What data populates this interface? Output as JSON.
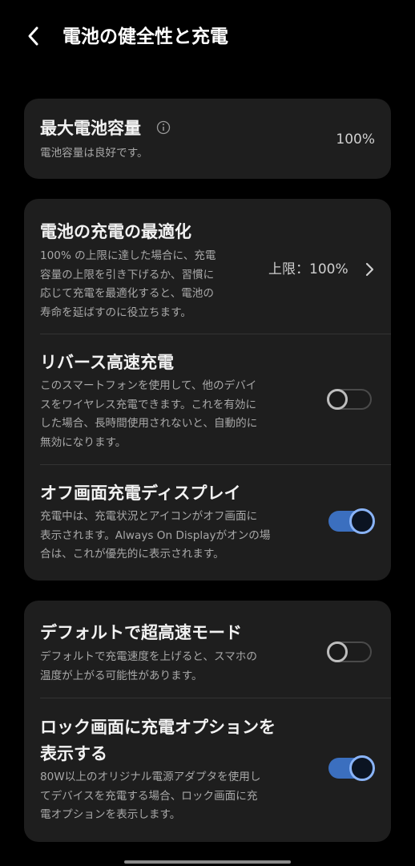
{
  "header": {
    "title": "電池の健全性と充電"
  },
  "capacity": {
    "title": "最大電池容量",
    "description": "電池容量は良好です。",
    "value": "100%"
  },
  "optimization": {
    "title": "電池の充電の最適化",
    "description": "100% の上限に達した場合に、充電\n容量の上限を引き下げるか、習慣に\n応じて充電を最適化すると、電池の\n寿命を延ばすのに役立ちます。",
    "value": "上限：100%"
  },
  "reverse_charging": {
    "title": "リバース高速充電",
    "description": "このスマートフォンを使用して、他のデバイ\nスをワイヤレス充電できます。これを有効に\nした場合、長時間使用されないと、自動的に\n無効になります。",
    "enabled": false
  },
  "off_screen_display": {
    "title": "オフ画面充電ディスプレイ",
    "description": "充電中は、充電状況とアイコンがオフ画面に\n表示されます。Always On Displayがオンの場\n合は、これが優先的に表示されます。",
    "enabled": true
  },
  "hyper_mode": {
    "title": "デフォルトで超高速モード",
    "description": "デフォルトで充電速度を上げると、スマホの\n温度が上がる可能性があります。",
    "enabled": false
  },
  "lock_screen_options": {
    "title_line1": "ロック画面に充電オプションを",
    "title_line2": "表示する",
    "description": "80W以上のオリジナル電源アダプタを使用し\nてデバイスを充電する場合、ロック画面に充\n電オプションを表示します。",
    "enabled": true
  },
  "icons": {
    "back": "chevron-left-icon",
    "info": "info-icon",
    "chevron": "chevron-right-icon"
  },
  "colors": {
    "background": "#000000",
    "card": "#1e1e1e",
    "accent": "#8ab4f8",
    "toggle_track_on": "#3b6fbf"
  }
}
